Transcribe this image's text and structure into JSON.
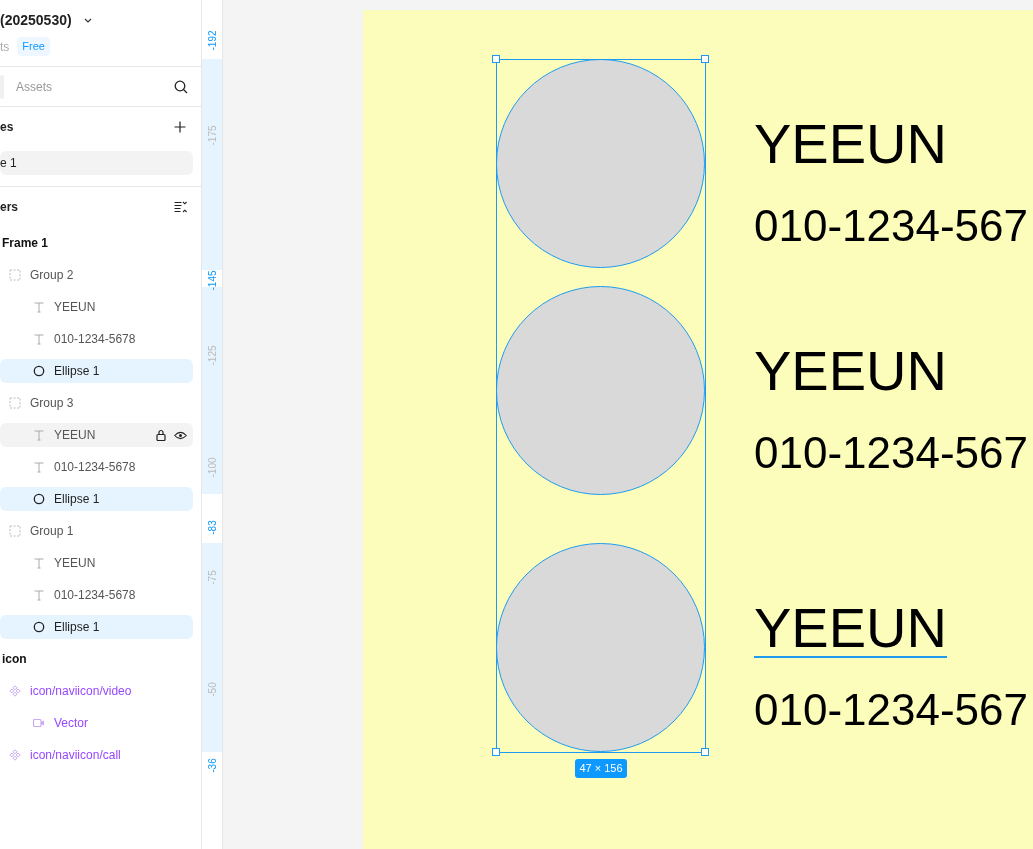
{
  "file": {
    "title": "(20250530)",
    "location": "ts",
    "plan": "Free"
  },
  "tabs": [
    {
      "selected": true
    },
    {
      "label": "Assets",
      "selected": false
    }
  ],
  "pages": {
    "title": "es",
    "items": [
      {
        "label": "e 1",
        "selected": true
      }
    ]
  },
  "layers": {
    "title": "ers",
    "tree": [
      {
        "kind": "frame",
        "name": "Frame 1",
        "selected": false,
        "hovered": false,
        "children": [
          {
            "kind": "group",
            "name": "Group 2",
            "selected": false,
            "hovered": false,
            "children": [
              {
                "kind": "text",
                "name": "YEEUN",
                "selected": false,
                "hovered": false
              },
              {
                "kind": "text",
                "name": "010-1234-5678",
                "selected": false,
                "hovered": false
              },
              {
                "kind": "ellipse",
                "name": "Ellipse 1",
                "selected": true,
                "hovered": false
              }
            ]
          },
          {
            "kind": "group",
            "name": "Group 3",
            "selected": false,
            "hovered": false,
            "children": [
              {
                "kind": "text",
                "name": "YEEUN",
                "selected": false,
                "hovered": true
              },
              {
                "kind": "text",
                "name": "010-1234-5678",
                "selected": false,
                "hovered": false
              },
              {
                "kind": "ellipse",
                "name": "Ellipse 1",
                "selected": true,
                "hovered": false
              }
            ]
          },
          {
            "kind": "group",
            "name": "Group 1",
            "selected": false,
            "hovered": false,
            "children": [
              {
                "kind": "text",
                "name": "YEEUN",
                "selected": false,
                "hovered": false
              },
              {
                "kind": "text",
                "name": "010-1234-5678",
                "selected": false,
                "hovered": false
              },
              {
                "kind": "ellipse",
                "name": "Ellipse 1",
                "selected": true,
                "hovered": false
              }
            ]
          }
        ]
      },
      {
        "kind": "frame",
        "name": "icon",
        "selected": false,
        "hovered": false,
        "children": [
          {
            "kind": "component",
            "name": "icon/naviicon/video",
            "selected": false,
            "hovered": false,
            "children": [
              {
                "kind": "vector",
                "name": "Vector",
                "selected": false,
                "hovered": false
              }
            ]
          },
          {
            "kind": "component",
            "name": "icon/naviicon/call",
            "selected": false,
            "hovered": false
          }
        ]
      }
    ]
  },
  "ruler": [
    {
      "text": "-192",
      "highlighted": true
    },
    {
      "text": "-175",
      "highlighted": false
    },
    {
      "text": "-145",
      "highlighted": true
    },
    {
      "text": "-125",
      "highlighted": false
    },
    {
      "text": "-100",
      "highlighted": false
    },
    {
      "text": "-83",
      "highlighted": true
    },
    {
      "text": "-75",
      "highlighted": false
    },
    {
      "text": "-50",
      "highlighted": false
    },
    {
      "text": "-36",
      "highlighted": true
    }
  ],
  "canvas": {
    "contacts": [
      {
        "name": "YEEUN",
        "phone": "010-1234-567",
        "selected": true,
        "hovered": false
      },
      {
        "name": "YEEUN",
        "phone": "010-1234-567",
        "selected": true,
        "hovered": false
      },
      {
        "name": "YEEUN",
        "phone": "010-1234-567",
        "selected": true,
        "hovered": true
      }
    ],
    "selection": {
      "size": "47 × 156"
    }
  }
}
